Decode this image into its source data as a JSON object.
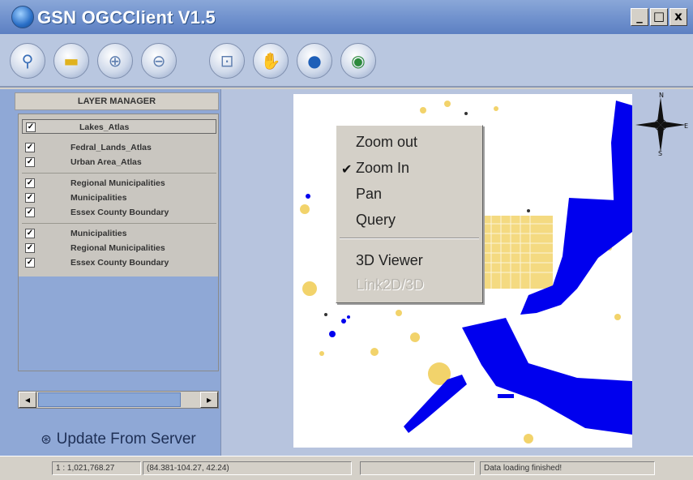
{
  "window": {
    "title": "GSN OGCClient V1.5",
    "controls": {
      "minimize": "_",
      "maximize": "□",
      "close": "x"
    }
  },
  "toolbar": {
    "tools": [
      {
        "name": "network-icon",
        "glyph": "⚲",
        "color": "#3a6fb8"
      },
      {
        "name": "folder-icon",
        "glyph": "▬",
        "color": "#e0b21e"
      },
      {
        "name": "zoom-in-icon",
        "glyph": "⊕",
        "color": "#5f7fb0"
      },
      {
        "name": "zoom-out-icon",
        "glyph": "⊖",
        "color": "#5f7fb0"
      },
      {
        "name": "zoom-extent-icon",
        "glyph": "⊡",
        "color": "#5f7fb0"
      },
      {
        "name": "pan-hand-icon",
        "glyph": "✋",
        "color": "#c88a3a"
      },
      {
        "name": "info-icon",
        "glyph": "●",
        "color": "#1e5fb8"
      },
      {
        "name": "globe-icon",
        "glyph": "◉",
        "color": "#2c8a3c"
      }
    ]
  },
  "layer_manager": {
    "title": "LAYER MANAGER",
    "layers": [
      {
        "label": "Lakes_Atlas",
        "checked": true
      },
      {
        "label": "Fedral_Lands_Atlas",
        "checked": true
      },
      {
        "label": "Urban Area_Atlas",
        "checked": true
      },
      {
        "label": "Regional Municipalities",
        "checked": true
      },
      {
        "label": "Municipalities",
        "checked": true
      },
      {
        "label": "Essex County Boundary",
        "checked": true
      },
      {
        "label": "Municipalities",
        "checked": true
      },
      {
        "label": "Regional Municipalities",
        "checked": true
      },
      {
        "label": "Essex County Boundary",
        "checked": true
      }
    ],
    "check_glyph": "✓",
    "scroll_left": "◂",
    "scroll_right": "▸",
    "update_button": "Update From Server",
    "update_icon": "⊛"
  },
  "context_menu": {
    "items": [
      {
        "label": "Zoom out",
        "checked": false,
        "disabled": false
      },
      {
        "label": "Zoom In",
        "checked": true,
        "disabled": false
      },
      {
        "label": "Pan",
        "checked": false,
        "disabled": false
      },
      {
        "label": "Query",
        "checked": false,
        "disabled": false
      },
      {
        "label": "3D Viewer",
        "checked": false,
        "disabled": false
      },
      {
        "label": "Link2D/3D",
        "checked": false,
        "disabled": true
      }
    ],
    "check_glyph": "✔"
  },
  "map": {
    "compass_labels": {
      "n": "N",
      "e": "E",
      "s": "S"
    },
    "colors": {
      "water": "#0000ee",
      "urban": "#f2d36b",
      "land": "#ffffff"
    }
  },
  "statusbar": {
    "scale": "1 : 1,021,768.27",
    "coords": "(84.381-104.27, 42.24)",
    "blank": "",
    "message": "Data loading finished!"
  }
}
